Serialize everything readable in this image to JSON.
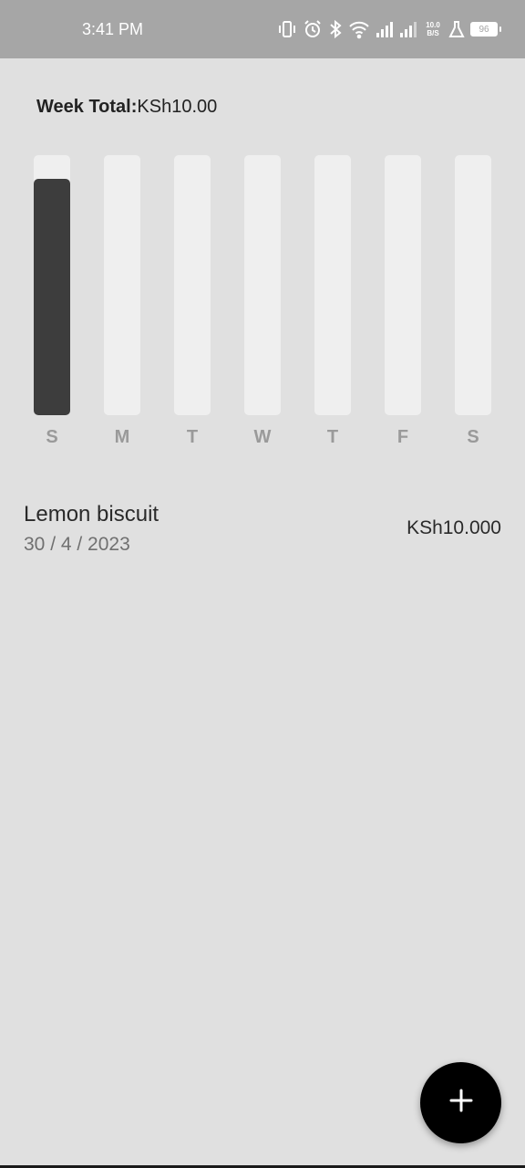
{
  "status_bar": {
    "time": "3:41 PM",
    "net_speed_value": "10.0",
    "net_speed_unit": "B/S",
    "battery": "96"
  },
  "summary": {
    "label": "Week Total:",
    "value": "KSh10.00"
  },
  "colors": {
    "bar_fill": "#3d3d3d",
    "bar_track": "#efefef",
    "background": "#e0e0e0",
    "fab": "#000000"
  },
  "chart_data": {
    "type": "bar",
    "categories": [
      "S",
      "M",
      "T",
      "W",
      "T",
      "F",
      "S"
    ],
    "values": [
      0.91,
      0,
      0,
      0,
      0,
      0,
      0
    ],
    "ylim": [
      0,
      1
    ],
    "grid": false
  },
  "transactions": [
    {
      "title": "Lemon biscuit",
      "date": "30 / 4 / 2023",
      "amount": "KSh10.000"
    }
  ],
  "fab": {
    "icon": "plus-icon"
  }
}
